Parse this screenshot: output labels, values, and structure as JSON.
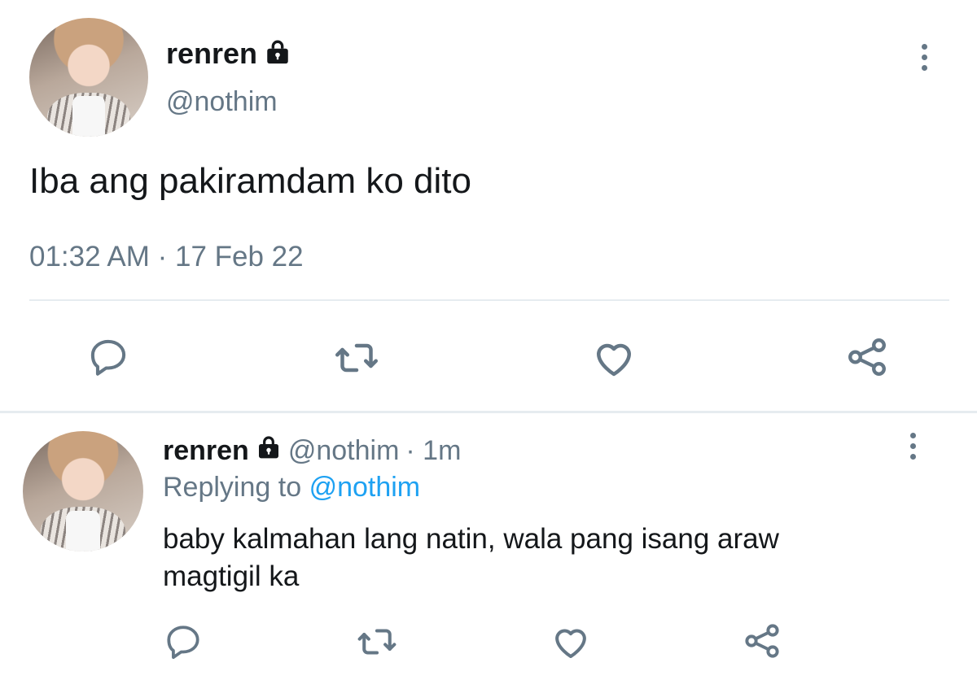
{
  "main_tweet": {
    "display_name": "renren",
    "handle": "@nothim",
    "text": "Iba ang pakiramdam ko dito",
    "timestamp": "01:32 AM · 17 Feb 22",
    "locked_icon": "lock-icon",
    "actions": [
      "reply-icon",
      "retweet-icon",
      "like-icon",
      "share-icon"
    ]
  },
  "reply_tweet": {
    "display_name": "renren",
    "handle": "@nothim",
    "time": "· 1m",
    "replying_prefix": "Replying to",
    "replying_to": "@nothim",
    "text_line1": "baby kalmahan lang natin, wala pang isang araw",
    "text_line2": "magtigil ka",
    "actions": [
      "reply-icon",
      "retweet-icon",
      "like-icon",
      "share-icon"
    ]
  },
  "colors": {
    "text": "#14171a",
    "muted": "#657786",
    "link": "#1da1f2",
    "divider": "#e6ecf0"
  }
}
